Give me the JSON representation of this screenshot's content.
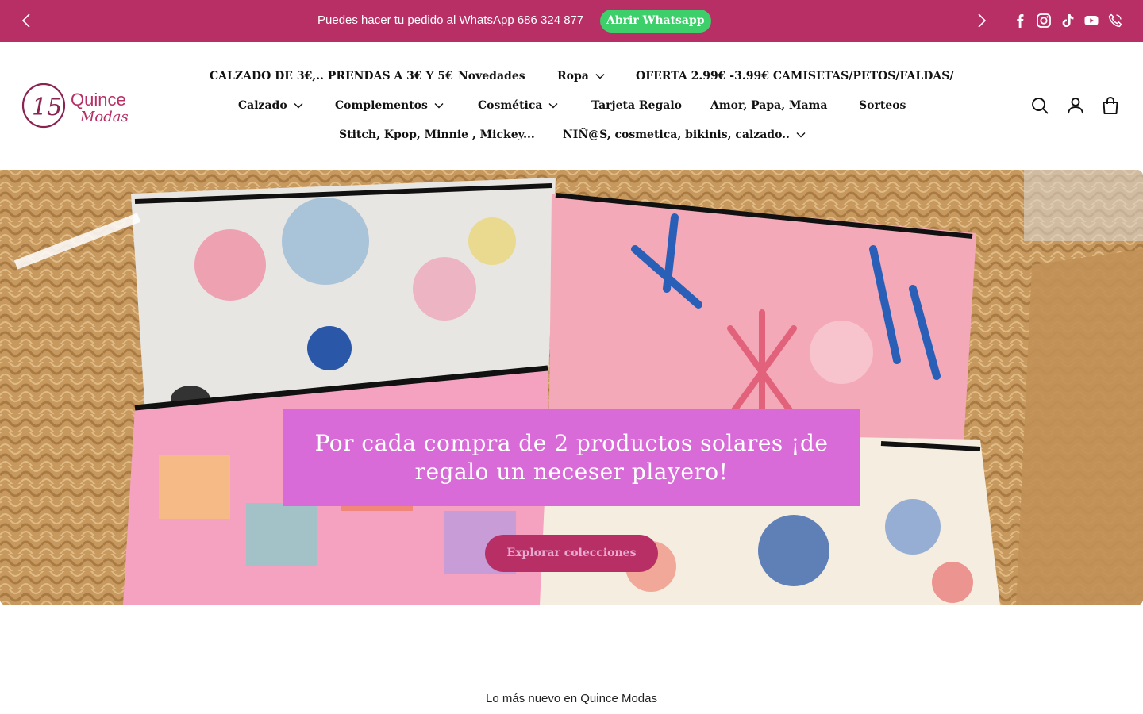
{
  "announcement": {
    "message": "Puedes hacer tu pedido al WhatsApp 686 324 877",
    "button_label": "Abrir Whatsapp",
    "background": "#b82f66",
    "button_color": "#3ccf6a",
    "social_icons": [
      "facebook-icon",
      "instagram-icon",
      "tiktok-icon",
      "youtube-icon",
      "phone-icon"
    ]
  },
  "logo": {
    "number": "15",
    "name_line1": "Quince",
    "name_line2": "Modas"
  },
  "nav": {
    "row1": [
      {
        "label": "CALZADO DE 3€,.. PRENDAS A 3€ Y 5€",
        "dropdown": false
      },
      {
        "label": "Novedades",
        "dropdown": false
      },
      {
        "label": "Ropa",
        "dropdown": true
      },
      {
        "label": "OFERTA 2.99€ -3.99€ CAMISETAS/PETOS/FALDAS/",
        "dropdown": false
      }
    ],
    "row2": [
      {
        "label": "Calzado",
        "dropdown": true
      },
      {
        "label": "Complementos",
        "dropdown": true
      },
      {
        "label": "Cosmética",
        "dropdown": true
      },
      {
        "label": "Tarjeta Regalo",
        "dropdown": false
      },
      {
        "label": "Amor, Papa, Mama",
        "dropdown": false
      },
      {
        "label": "Sorteos",
        "dropdown": false
      }
    ],
    "row3": [
      {
        "label": "Stitch, Kpop, Minnie , Mickey...",
        "dropdown": false
      },
      {
        "label": "NIÑ@S, cosmetica, bikinis, calzado..",
        "dropdown": true
      }
    ]
  },
  "header_icons": [
    "search-icon",
    "account-icon",
    "cart-icon"
  ],
  "hero": {
    "promo_text": "Por cada compra de 2 productos solares ¡de regalo un neceser playero!",
    "cta_label": "Explorar colecciones",
    "promo_color": "#d86bd8",
    "cta_color": "#b82f66"
  },
  "section": {
    "title": "Lo más nuevo en Quince Modas"
  }
}
